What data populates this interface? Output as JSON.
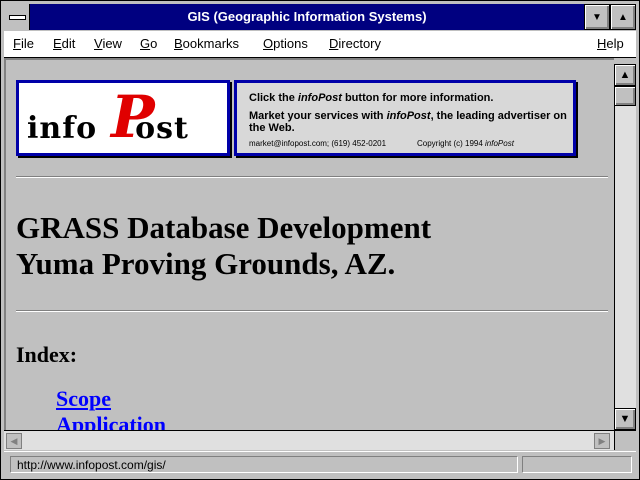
{
  "window": {
    "title": "GIS (Geographic Information Systems)"
  },
  "menu": {
    "items": [
      {
        "label": "File"
      },
      {
        "label": "Edit"
      },
      {
        "label": "View"
      },
      {
        "label": "Go"
      },
      {
        "label": "Bookmarks"
      },
      {
        "label": "Options"
      },
      {
        "label": "Directory"
      },
      {
        "label": "Help"
      }
    ]
  },
  "banner": {
    "logo_text": "info",
    "logo_p": "P",
    "logo_rest": "ost",
    "ad_line1_pre": "Click the ",
    "ad_line1_brand": "infoPost",
    "ad_line1_post": " button for more information.",
    "ad_line2_pre": "Market your services with ",
    "ad_line2_brand": "infoPost",
    "ad_line2_post": ", the leading advertiser on the Web.",
    "ad_contact": "market@infopost.com; (619) 452-0201",
    "ad_copyright_pre": "Copyright (c) 1994 ",
    "ad_copyright_brand": "infoPost"
  },
  "page": {
    "heading_line1": "GRASS Database Development",
    "heading_line2": "Yuma Proving Grounds, AZ.",
    "index_heading": "Index:",
    "links": [
      {
        "label": "Scope"
      },
      {
        "label": "Application"
      }
    ]
  },
  "status": {
    "url": "http://www.infopost.com/gis/"
  },
  "colors": {
    "titlebar": "#000080",
    "link": "#0000ff",
    "logo_accent": "#e00000",
    "banner_border": "#0000a8"
  }
}
